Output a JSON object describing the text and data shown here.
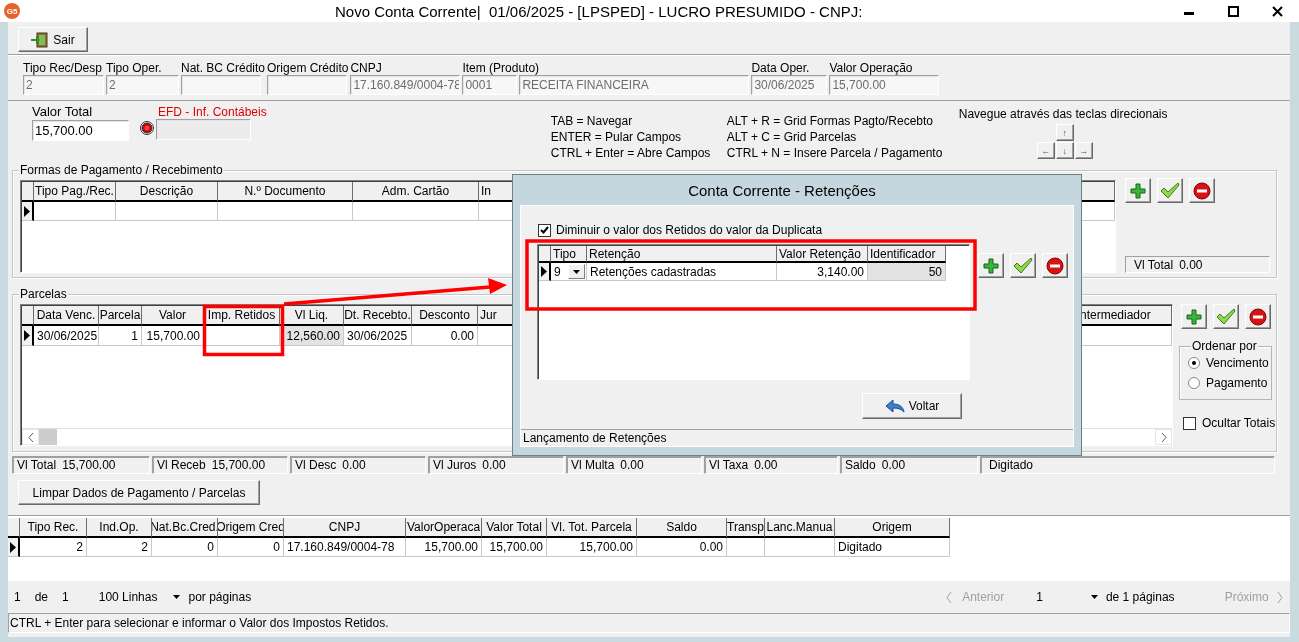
{
  "window": {
    "logo": "G5",
    "title": "Novo Conta Corrente|  01/06/2025 - [LPSPED] - LUCRO PRESUMIDO - CNPJ:"
  },
  "toolbar": {
    "exit_button": "Sair"
  },
  "header_fields": [
    {
      "label": "Tipo Rec/Desp",
      "value": "2"
    },
    {
      "label": "Tipo Oper.",
      "value": "2"
    },
    {
      "label": "Nat. BC Crédito"
    },
    {
      "label": "Origem Crédito"
    },
    {
      "label": "CNPJ",
      "value": "17.160.849/0004-78"
    },
    {
      "label": "Item (Produto)",
      "value": "0001",
      "value_2": "RECEITA FINANCEIRA"
    },
    {
      "label": "Data Oper.",
      "value": "30/06/2025"
    },
    {
      "label": "Valor Operação",
      "value": "15,700.00"
    }
  ],
  "valor_total": {
    "label": "Valor Total",
    "value": "15,700.00"
  },
  "efd": {
    "label": "EFD - Inf. Contábeis"
  },
  "shortcut_columns": [
    {
      "lines": [
        "TAB = Navegar",
        "ENTER = Pular Campos",
        "CTRL + Enter = Abre Campos"
      ]
    },
    {
      "lines": [
        "ALT + R = Grid Formas Pagto/Recebto",
        "ALT + C = Grid Parcelas",
        "CTRL + N = Insere Parcela / Pagamento"
      ]
    }
  ],
  "navigation": {
    "hint": "Navegue através das teclas direcionais",
    "keys": [
      "↑",
      "←",
      "↓",
      "→"
    ]
  },
  "payments": {
    "title": "Formas de Pagamento / Recebimento",
    "columns": [
      {
        "label": "Tipo Pag./Rec."
      },
      {
        "label": "Descrição"
      },
      {
        "label": "N.º Documento"
      },
      {
        "label": "Adm. Cartão"
      },
      {
        "label": "In"
      }
    ],
    "rows": [
      {
        "current": true
      }
    ],
    "total": {
      "label": "Vl Total",
      "value": "0.00"
    }
  },
  "installments": {
    "title": "Parcelas",
    "columns": [
      {
        "label": "Data Venc."
      },
      {
        "label": "Parcela"
      },
      {
        "label": "Valor"
      },
      {
        "label": "Imp. Retidos"
      },
      {
        "label": "Vl Liq."
      },
      {
        "label": "Dt. Recebto."
      },
      {
        "label": "Desconto"
      },
      {
        "label": "Jur"
      },
      {
        "label": "ntermediador"
      }
    ],
    "rows": [
      {
        "current": true,
        "data_venc": "30/06/2025",
        "parcela": "1",
        "valor": "15,700.00",
        "vl_liq": "12,560.00",
        "dt_recebto": "30/06/2025",
        "desconto": "0.00"
      }
    ],
    "order_by": {
      "title": "Ordenar por",
      "options": [
        {
          "label": "Vencimento",
          "selected": true
        },
        {
          "label": "Pagamento",
          "selected": false
        }
      ]
    },
    "hide_totals": {
      "label": "Ocultar Totais",
      "checked": false
    }
  },
  "totals": [
    {
      "label": "Vl Total",
      "value": "15,700.00"
    },
    {
      "label": "Vl Receb",
      "value": "15,700.00"
    },
    {
      "label": "Vl Desc",
      "value": "0.00"
    },
    {
      "label": "Vl Juros",
      "value": "0.00"
    },
    {
      "label": "Vl Multa",
      "value": "0.00"
    },
    {
      "label": "Vl Taxa",
      "value": "0.00"
    },
    {
      "label": "Saldo",
      "value": "0.00"
    },
    {
      "value": "Digitado"
    }
  ],
  "clear_button": "Limpar Dados de Pagamento / Parcelas",
  "records": {
    "columns": [
      {
        "label": "Tipo Rec."
      },
      {
        "label": "Ind.Op."
      },
      {
        "label": "Nat.Bc.Cred."
      },
      {
        "label": "Origem Cred"
      },
      {
        "label": "CNPJ"
      },
      {
        "label": "ValorOperaca"
      },
      {
        "label": "Valor Total"
      },
      {
        "label": "Vl. Tot. Parcela"
      },
      {
        "label": "Saldo"
      },
      {
        "label": "Transp"
      },
      {
        "label": "Lanc.Manua"
      },
      {
        "label": "Origem"
      }
    ],
    "rows": [
      {
        "current": true,
        "tipo_rec": "2",
        "ind_op": "2",
        "nat": "0",
        "origem_cred": "0",
        "cnpj": "17.160.849/0004-78",
        "valor_op": "15,700.00",
        "valor_total": "15,700.00",
        "vl_parcela": "15,700.00",
        "saldo": "0.00",
        "origem": "Digitado"
      }
    ]
  },
  "pagination": {
    "page": "1",
    "of": "de",
    "page_count": "1",
    "page_size": "100 Linhas",
    "per_page": "por páginas",
    "previous": {
      "label": "Anterior",
      "disabled": true
    },
    "current_page": "1",
    "pages_label": "de 1 páginas",
    "next": {
      "label": "Próximo",
      "disabled": true
    }
  },
  "status_bar": "CTRL + Enter para selecionar e informar o Valor dos Impostos Retidos.",
  "dialog": {
    "title": "Conta Corrente - Retenções",
    "deduct": {
      "label": "Diminuir o valor dos Retidos do valor da Duplicata",
      "checked": true
    },
    "columns": [
      {
        "label": "Tipo",
        "kind": "dropdown"
      },
      {
        "label": "Retenção",
        "kind": "text"
      },
      {
        "label": "Valor Retenção",
        "kind": "text"
      },
      {
        "label": "Identificador",
        "kind": "text"
      }
    ],
    "rows": [
      {
        "current": true,
        "tipo": "9",
        "retencao": "Retenções cadastradas",
        "valor": "3,140.00",
        "identificador": "50"
      }
    ],
    "back_button": "Voltar",
    "status": "Lançamento de Retenções"
  }
}
